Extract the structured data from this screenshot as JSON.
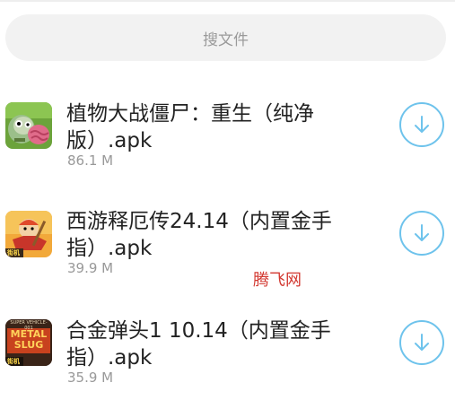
{
  "search": {
    "placeholder": "搜文件"
  },
  "files": [
    {
      "title": "植物大战僵尸：重生（纯净版）.apk",
      "size": "86.1 M",
      "icon": "plants-vs-zombies-app-icon"
    },
    {
      "title": "西游释厄传24.14（内置金手指）.apk",
      "size": "39.9 M",
      "icon": "xiyou-shiechuan-app-icon",
      "icon_badge": "街机"
    },
    {
      "title": "合金弹头1 10.14（内置金手指）.apk",
      "size": "35.9 M",
      "icon": "metal-slug-app-icon",
      "icon_badge": "街机",
      "icon_text": "METAL SLUG",
      "icon_subtext": "SUPER VEHICLE-001"
    }
  ],
  "download_icon": "download-arrow-icon",
  "watermark": "腾飞网",
  "colors": {
    "accent": "#6ec3ec",
    "title": "#222222",
    "size": "#999999",
    "watermark": "#d2372f",
    "search_bg": "#f2f2f2"
  }
}
